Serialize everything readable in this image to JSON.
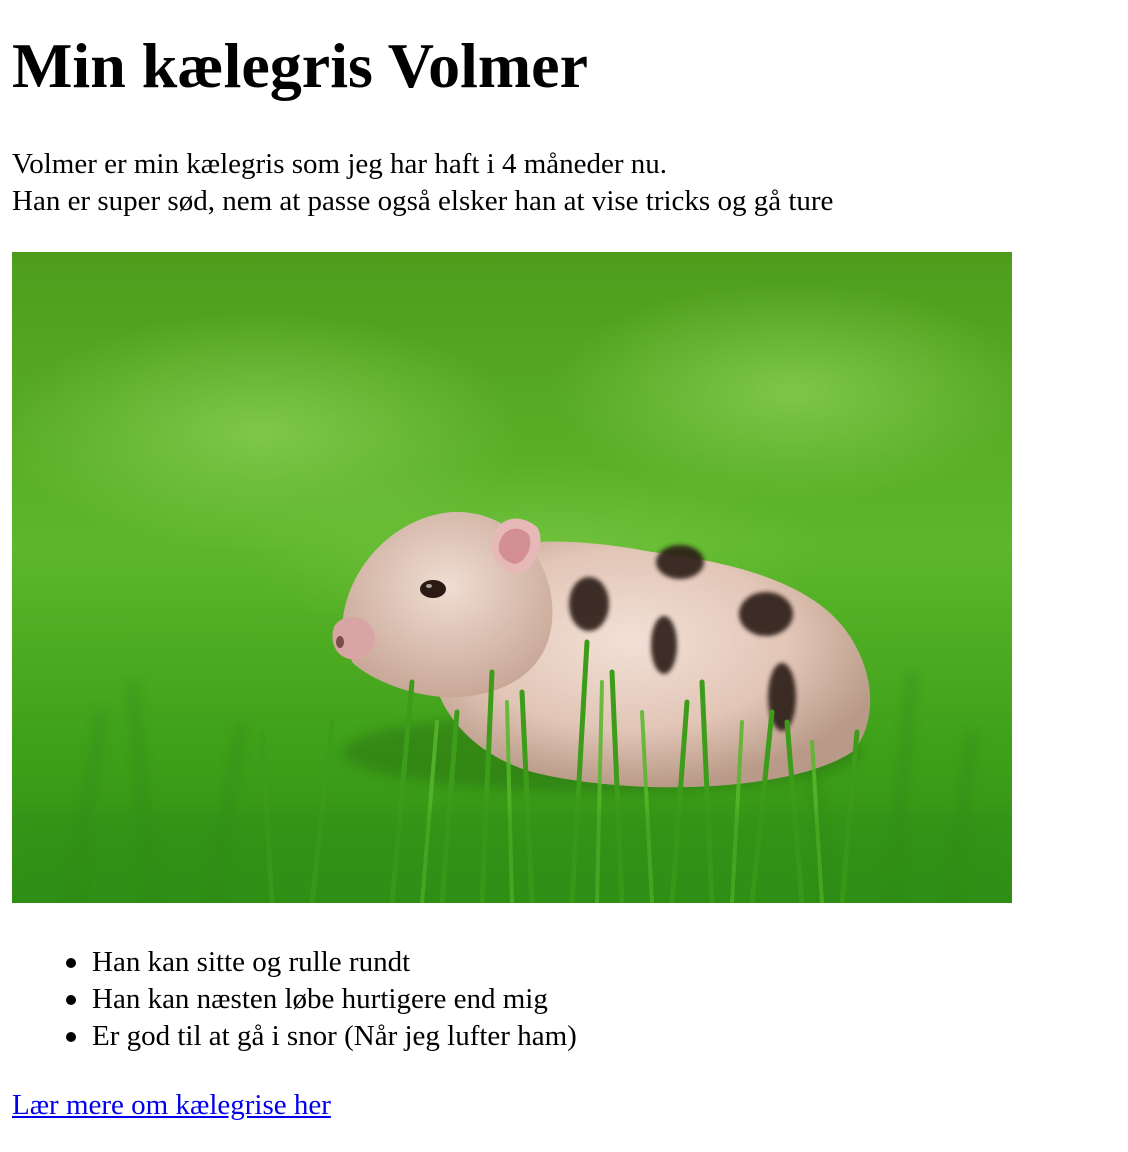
{
  "page": {
    "title": "Min kælegris Volmer",
    "intro_lines": [
      "Volmer er min kælegris som jeg har haft i 4 måneder nu.",
      "Han er super sød, nem at passe også elsker han at vise tricks og gå ture"
    ],
    "image": {
      "subject": "piglet-in-grass-photo"
    },
    "tricks": [
      "Han kan sitte og rulle rundt",
      "Han kan næsten løbe hurtigere end mig",
      "Er god til at gå i snor (Når jeg lufter ham)"
    ],
    "link_text": "Lær mere om kælegrise her",
    "colors": {
      "link": "#0000ee",
      "text": "#000000",
      "grass": "#3f9e1d"
    }
  }
}
